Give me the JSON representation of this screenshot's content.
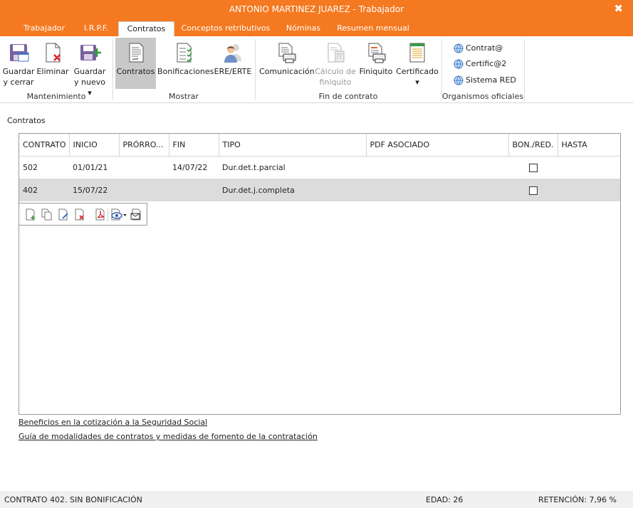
{
  "window": {
    "title": "ANTONIO MARTINEZ JUAREZ - Trabajador",
    "close_glyph": "✖"
  },
  "tabs": [
    {
      "label": "Trabajador"
    },
    {
      "label": "I.R.P.F."
    },
    {
      "label": "Contratos",
      "active": true
    },
    {
      "label": "Conceptos retributivos"
    },
    {
      "label": "Nóminas"
    },
    {
      "label": "Resumen mensual"
    }
  ],
  "ribbon": {
    "mantenimiento": {
      "label": "Mantenimiento",
      "guardar_cerrar": {
        "line1": "Guardar",
        "line2": "y cerrar",
        "icon": "save-close-icon"
      },
      "eliminar": {
        "line1": "Eliminar",
        "icon": "delete-doc-icon"
      },
      "guardar_nuevo": {
        "line1": "Guardar",
        "line2": "y nuevo ▾",
        "icon": "save-new-icon"
      }
    },
    "mostrar": {
      "label": "Mostrar",
      "contratos": {
        "line1": "Contratos",
        "icon": "contracts-doc-icon"
      },
      "bonificaciones": {
        "line1": "Bonificaciones",
        "icon": "checklist-doc-icon"
      },
      "ere_erte": {
        "line1": "ERE/ERTE",
        "icon": "people-icon"
      }
    },
    "fin_contrato": {
      "label": "Fin de contrato",
      "comunicacion": {
        "line1": "Comunicación",
        "icon": "print-doc-icon"
      },
      "calculo": {
        "line1": "Cálculo de",
        "line2": "finiquito",
        "icon": "calculator-doc-icon"
      },
      "finiquito": {
        "line1": "Finiquito",
        "icon": "print-doc-icon"
      },
      "certificado": {
        "line1": "Certificado",
        "line2": "▾",
        "icon": "certificate-doc-icon"
      }
    },
    "organismos": {
      "label": "Organismos oficiales",
      "items": [
        {
          "label": "Contrat@",
          "icon": "globe-icon"
        },
        {
          "label": "Certific@2",
          "icon": "globe-icon"
        },
        {
          "label": "Sistema RED",
          "icon": "globe-icon"
        }
      ]
    }
  },
  "main": {
    "section_title": "Contratos",
    "columns": [
      "CONTRATO",
      "INICIO",
      "PRÓRRO...",
      "FIN",
      "TIPO",
      "PDF ASOCIADO",
      "BON./RED.",
      "HASTA"
    ],
    "rows": [
      {
        "contrato": "502",
        "inicio": "01/01/21",
        "prorroga": "",
        "fin": "14/07/22",
        "tipo": "Dur.det.t.parcial",
        "pdf": "",
        "bon_red": false,
        "hasta": ""
      },
      {
        "contrato": "402",
        "inicio": "15/07/22",
        "prorroga": "",
        "fin": "",
        "tipo": "Dur.det.j.completa",
        "pdf": "",
        "bon_red": false,
        "hasta": "",
        "selected": true
      }
    ],
    "mini_toolbar": [
      "new-doc-icon",
      "copy-doc-icon",
      "edit-doc-icon",
      "delete-doc-icon",
      "pdf-icon",
      "view-dropdown-icon",
      "email-icon"
    ],
    "links": [
      "Beneficios en la cotización a la Seguridad Social",
      "Guía de modalidades de contratos y medidas de fomento de la contratación"
    ]
  },
  "status": {
    "contrato": "CONTRATO 402.  SIN BONIFICACIÓN",
    "edad": "EDAD: 26",
    "retencion": "RETENCIÓN: 7,96 %"
  },
  "colors": {
    "accent": "#f47920",
    "selected_row": "#dcdcdc",
    "active_button": "#c8c8c8"
  }
}
